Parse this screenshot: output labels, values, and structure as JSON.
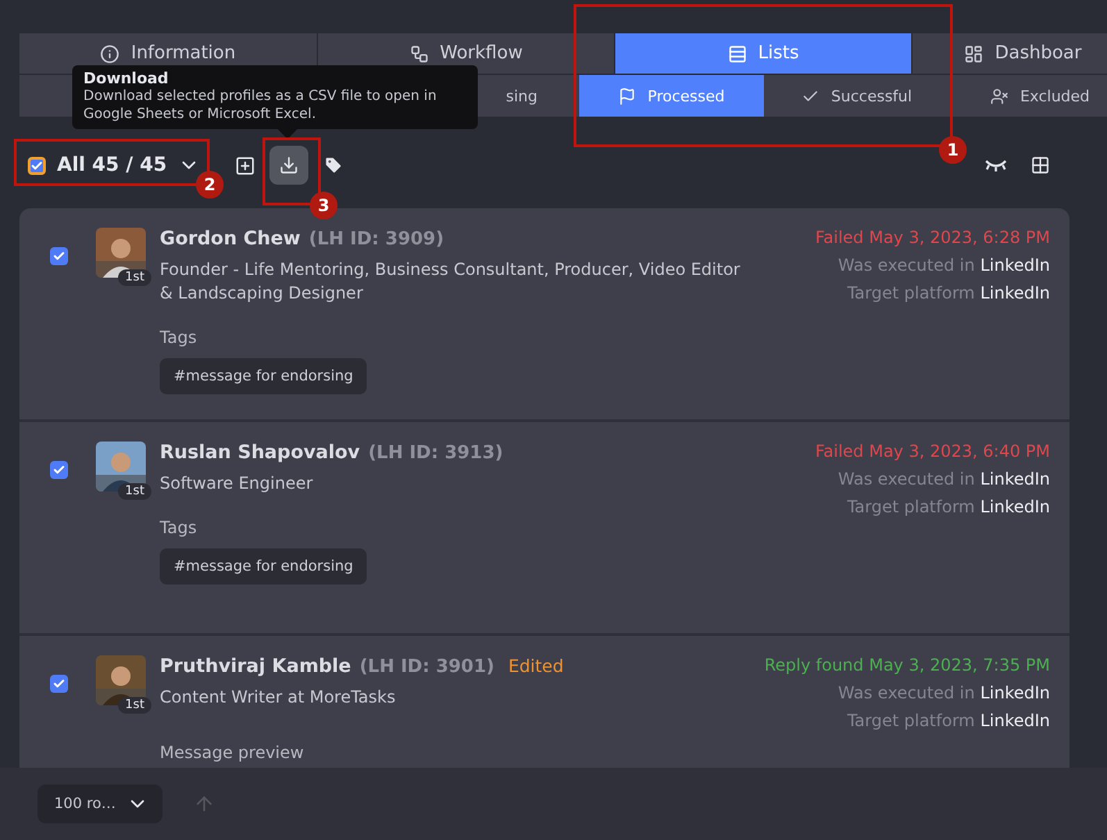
{
  "tabs": [
    {
      "label": "Information",
      "selected": false
    },
    {
      "label": "Workflow",
      "selected": false
    },
    {
      "label": "Lists",
      "selected": true
    },
    {
      "label": "Dashboar",
      "selected": false
    }
  ],
  "subtabs": [
    {
      "label": "sing",
      "selected": false
    },
    {
      "label": "Processed",
      "selected": true
    },
    {
      "label": "Successful",
      "selected": false
    },
    {
      "label": "Excluded",
      "selected": false
    }
  ],
  "tooltip": {
    "title": "Download",
    "text": "Download selected profiles as a CSV file to open in Google Sheets or Microsoft Excel."
  },
  "toolbar": {
    "select_all": {
      "checked": true,
      "label": "All 45 / 45"
    }
  },
  "profiles": [
    {
      "checked": true,
      "degree": "1st",
      "name": "Gordon Chew",
      "lh_id": "(LH ID: 3909)",
      "headline": "Founder - Life Mentoring, Business Consultant, Producer, Video Editor & Landscaping Designer",
      "status": {
        "kind": "failed",
        "text": "Failed May 3, 2023, 6:28 PM"
      },
      "executed_label": "Was executed in",
      "executed_value": "LinkedIn",
      "target_label": "Target platform",
      "target_value": "LinkedIn",
      "section_label": "Tags",
      "tag": "#message for endorsing"
    },
    {
      "checked": true,
      "degree": "1st",
      "name": "Ruslan Shapovalov",
      "lh_id": "(LH ID: 3913)",
      "headline": "Software Engineer",
      "status": {
        "kind": "failed",
        "text": "Failed May 3, 2023, 6:40 PM"
      },
      "executed_label": "Was executed in",
      "executed_value": "LinkedIn",
      "target_label": "Target platform",
      "target_value": "LinkedIn",
      "section_label": "Tags",
      "tag": "#message for endorsing"
    },
    {
      "checked": true,
      "degree": "1st",
      "name": "Pruthviraj Kamble",
      "lh_id": "(LH ID: 3901)",
      "edited": "Edited",
      "headline": "Content Writer at MoreTasks",
      "status": {
        "kind": "success",
        "text": "Reply found May 3, 2023, 7:35 PM"
      },
      "executed_label": "Was executed in",
      "executed_value": "LinkedIn",
      "target_label": "Target platform",
      "target_value": "LinkedIn",
      "section_label": "Message preview"
    }
  ],
  "footer": {
    "rows_select": "100 ro…"
  },
  "annotations": [
    {
      "label": "1"
    },
    {
      "label": "2"
    },
    {
      "label": "3"
    }
  ]
}
